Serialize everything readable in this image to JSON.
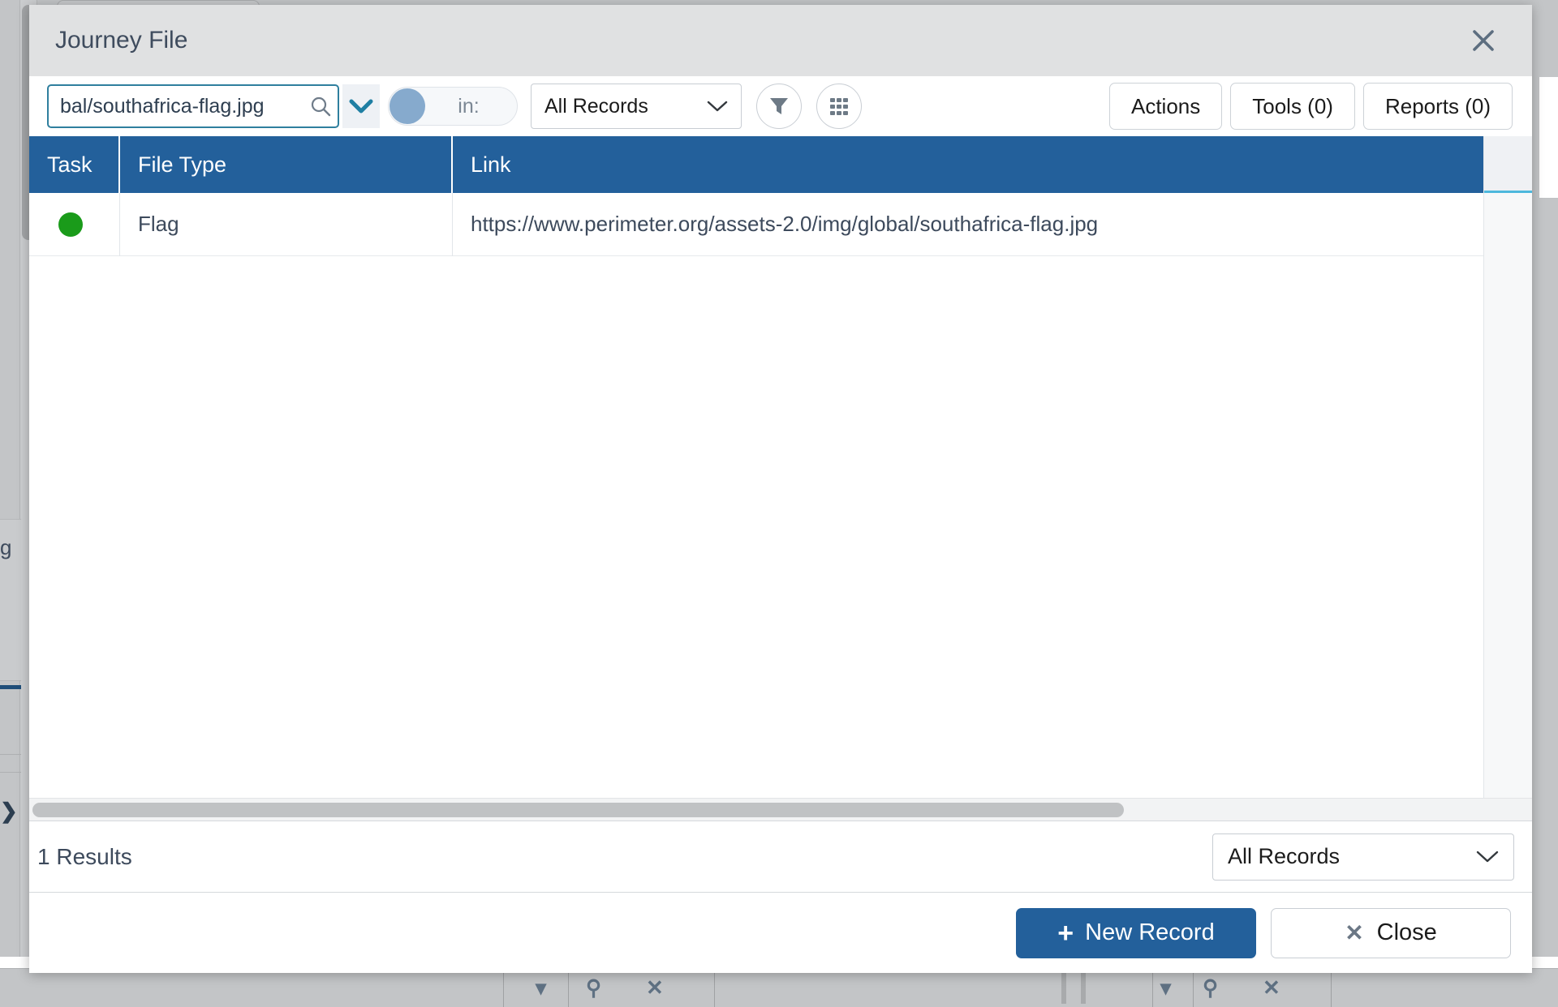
{
  "dialog": {
    "title": "Journey File",
    "close_icon": "close-icon"
  },
  "toolbar": {
    "search_value": "bal/southafrica-flag.jpg",
    "search_placeholder": "Search",
    "search_icon": "search-icon",
    "caret_icon": "chevron-down-icon",
    "toggle_label": "in:",
    "scope_select_value": "All Records",
    "filter_icon": "filter-icon",
    "grid_icon": "grid-icon",
    "actions_label": "Actions",
    "tools_label": "Tools (0)",
    "reports_label": "Reports (0)"
  },
  "table": {
    "columns": [
      "Task",
      "File Type",
      "Link"
    ],
    "rows": [
      {
        "task_status": "green",
        "file_type": "Flag",
        "link": "https://www.perimeter.org/assets-2.0/img/global/southafrica-flag.jpg"
      }
    ]
  },
  "results": {
    "count_label": "1 Results",
    "select_value": "All Records"
  },
  "footer": {
    "new_record_label": "New Record",
    "new_record_glyph": "+",
    "close_label": "Close",
    "close_glyph": "✕"
  },
  "colors": {
    "header_blue": "#23609b",
    "accent_teal": "#2f7f9e",
    "status_green": "#1a9b1a",
    "titlebar_gray": "#e0e1e2"
  }
}
